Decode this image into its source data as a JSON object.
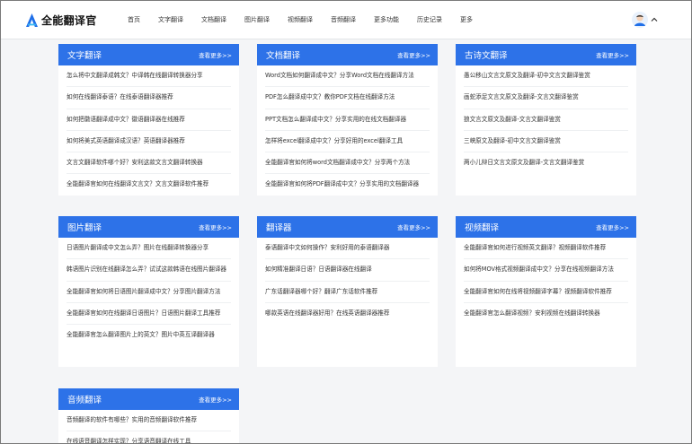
{
  "header": {
    "logo_text": "全能翻译官",
    "nav": [
      "首页",
      "文字翻译",
      "文档翻译",
      "图片翻译",
      "视频翻译",
      "音频翻译",
      "更多功能",
      "历史记录",
      "更多"
    ]
  },
  "cards": [
    {
      "title": "文字翻译",
      "more": "查看更多>>",
      "items": [
        "怎么将中文翻译成韩文？中译韩在线翻译转换器分享",
        "如何在线翻译泰语？在线泰语翻译器推荐",
        "如何把徽语翻译成中文？徽语翻译器在线推荐",
        "如何将美式英语翻译成汉语？英语翻译器推荐",
        "文言文翻译软件哪个好？安利这款文言文翻译转换器",
        "全能翻译官如何在线翻译文言文？文言文翻译软件推荐"
      ]
    },
    {
      "title": "文档翻译",
      "more": "查看更多>>",
      "items": [
        "Word文档如何翻译成中文？分享Word文档在线翻译方法",
        "PDF怎么翻译成中文？教你PDF文档在线翻译方法",
        "PPT文档怎么翻译成中文？分享实用的在线文档翻译器",
        "怎样将excel翻译成中文？分享好用的excel翻译工具",
        "全能翻译官如何将word文档翻译成中文？分享两个方法",
        "全能翻译官如何将PDF翻译成中文？分享实用的文档翻译器"
      ]
    },
    {
      "title": "古诗文翻译",
      "more": "查看更多>>",
      "items": [
        "愚公移山文言文原文及翻译-初中文言文翻译鉴赏",
        "画蛇添足文言文原文及翻译-文言文翻译鉴赏",
        "狼文言文原文及翻译-文言文翻译鉴赏",
        "三峡原文及翻译-初中文言文翻译鉴赏",
        "两小儿辩日文言文原文及翻译-文言文翻译鉴赏"
      ]
    },
    {
      "title": "图片翻译",
      "more": "查看更多>>",
      "items": [
        "日语图片翻译成中文怎么弄？图片在线翻译转换器分享",
        "韩语图片识别在线翻译怎么弄？试试这款韩语在线图片翻译器",
        "全能翻译官如何将日语图片翻译成中文？分享图片翻译方法",
        "全能翻译官如何在线翻译日语图片？日语图片翻译工具推荐",
        "全能翻译官怎么翻译图片上的英文？图片中英互译翻译器"
      ]
    },
    {
      "title": "翻译器",
      "more": "查看更多>>",
      "items": [
        "泰语翻译中文如何操作？安利好用的泰语翻译器",
        "如何精准翻译日语？日语翻译器在线翻译",
        "广东话翻译器哪个好？翻译广东话软件推荐",
        "哪款英语在线翻译器好用？在线英语翻译器推荐"
      ]
    },
    {
      "title": "视频翻译",
      "more": "查看更多>>",
      "items": [
        "全能翻译官如何进行视频英文翻译？视频翻译软件推荐",
        "如何将MOV格式视频翻译成中文？分享在线视频翻译方法",
        "全能翻译官如何在线将视频翻译字幕？视频翻译软件推荐",
        "全能翻译官怎么翻译视频？安利视频在线翻译转换器"
      ]
    },
    {
      "title": "音频翻译",
      "more": "查看更多>>",
      "items": [
        "音频翻译的软件有哪些？实用的音频翻译软件推荐",
        "在线语音翻译怎样实现？分享语音翻译在线工具"
      ]
    }
  ],
  "colors": {
    "accent": "#2d72e8",
    "background": "#f4f5f7",
    "card": "#ffffff"
  },
  "icons": {
    "logo": "logo-a-icon",
    "avatar": "user-avatar-icon",
    "caret": "chevron-up-icon"
  }
}
